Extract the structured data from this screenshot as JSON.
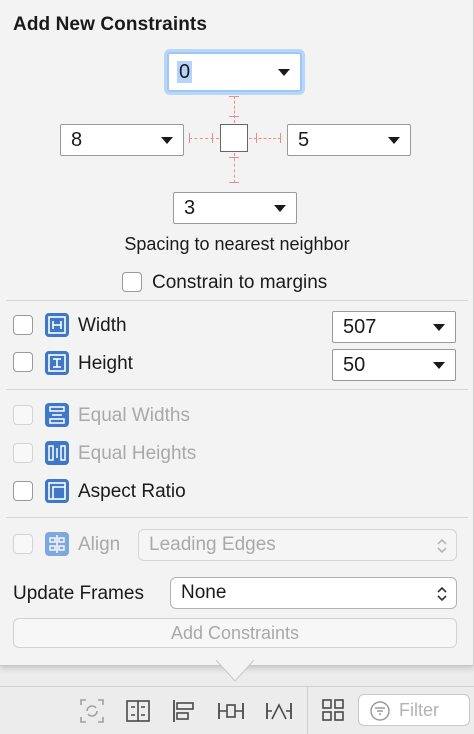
{
  "popover": {
    "title": "Add New Constraints",
    "spacing": {
      "top": "0",
      "left": "8",
      "right": "5",
      "bottom": "3",
      "caption": "Spacing to nearest neighbor"
    },
    "constrain_to_margins": {
      "label": "Constrain to margins",
      "checked": false
    },
    "width": {
      "label": "Width",
      "value": "507",
      "checked": false
    },
    "height": {
      "label": "Height",
      "value": "50",
      "checked": false
    },
    "equal_widths": {
      "label": "Equal Widths",
      "enabled": false
    },
    "equal_heights": {
      "label": "Equal Heights",
      "enabled": false
    },
    "aspect_ratio": {
      "label": "Aspect Ratio",
      "checked": false
    },
    "align": {
      "label": "Align",
      "value": "Leading Edges",
      "enabled": false
    },
    "update_frames": {
      "label": "Update Frames",
      "value": "None"
    },
    "add_button": {
      "label": "Add Constraints",
      "enabled": false
    }
  },
  "toolbar": {
    "icons": [
      "update-frames-icon",
      "stack-icon",
      "align-icon",
      "pin-icon",
      "resolve-icon",
      "grid-icon"
    ],
    "filter_placeholder": "Filter"
  },
  "colors": {
    "icon_blue": "#3f78c6",
    "focus_ring": "#9ec7f5",
    "strut_red": "#f08a8a"
  }
}
